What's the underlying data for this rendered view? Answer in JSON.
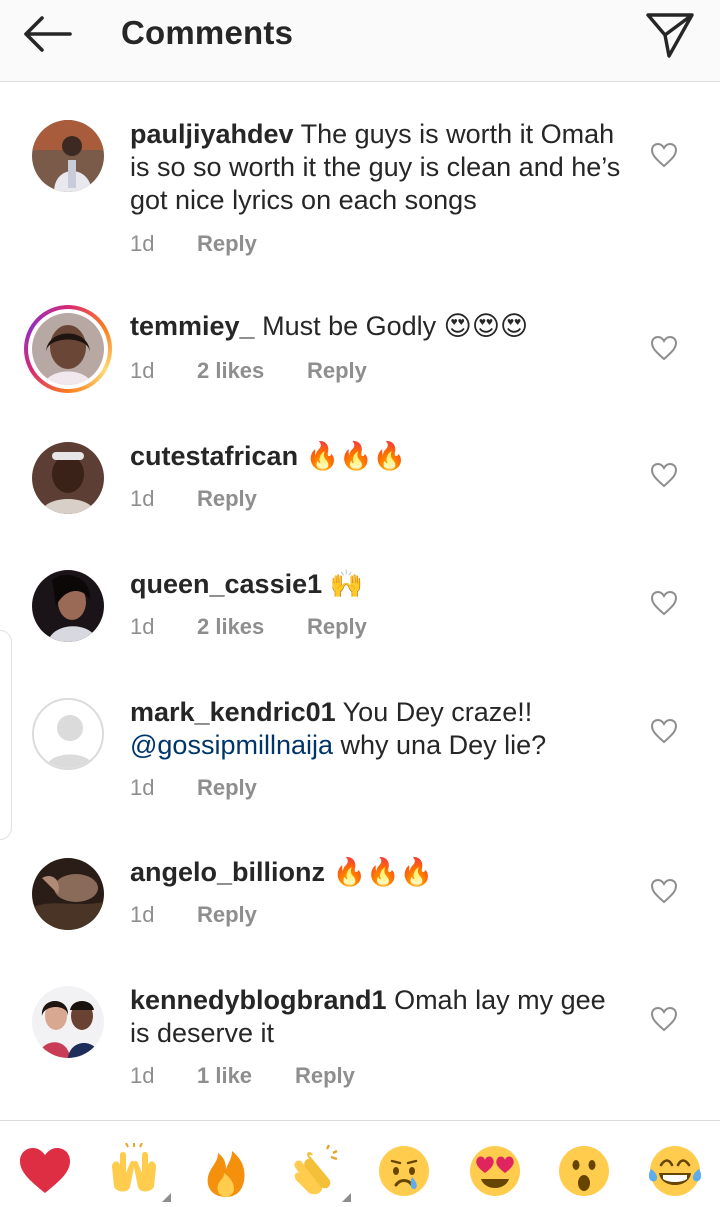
{
  "header": {
    "title": "Comments",
    "back_icon": "arrow-left-icon",
    "share_icon": "paper-plane-icon"
  },
  "comments": [
    {
      "username": "pauljiyahdev",
      "text": "The guys is worth it Omah is so so worth it the guy is clean and he’s got nice lyrics on each songs",
      "time": "1d",
      "likes": "",
      "reply": "Reply",
      "story_ring": false
    },
    {
      "username": "temmiey_",
      "text": "Must be Godly 😍😍😍",
      "time": "1d",
      "likes": "2 likes",
      "reply": "Reply",
      "story_ring": true
    },
    {
      "username": "cutestafrican",
      "text": "🔥🔥🔥",
      "time": "1d",
      "likes": "",
      "reply": "Reply",
      "story_ring": false
    },
    {
      "username": "queen_cassie1",
      "text": "🙌",
      "time": "1d",
      "likes": "2 likes",
      "reply": "Reply",
      "story_ring": false
    },
    {
      "username": "mark_kendric01",
      "text": "You Dey craze!!",
      "mention": "@gossipmillnaija",
      "text_after": "why una Dey lie?",
      "time": "1d",
      "likes": "",
      "reply": "Reply",
      "story_ring": false
    },
    {
      "username": "angelo_billionz",
      "text": "🔥🔥🔥",
      "time": "1d",
      "likes": "",
      "reply": "Reply",
      "story_ring": false
    },
    {
      "username": "kennedyblogbrand1",
      "text": "Omah lay my gee is deserve it",
      "time": "1d",
      "likes": "1 like",
      "reply": "Reply",
      "story_ring": false
    }
  ],
  "emoji_bar": [
    "red-heart",
    "raising-hands",
    "fire",
    "clapping-hands",
    "crying-face",
    "heart-eyes",
    "surprised-face",
    "tears-of-joy"
  ],
  "colors": {
    "username": "#262626",
    "meta": "#8e8e8e",
    "mention": "#003569",
    "header_bg": "#fafafa"
  }
}
